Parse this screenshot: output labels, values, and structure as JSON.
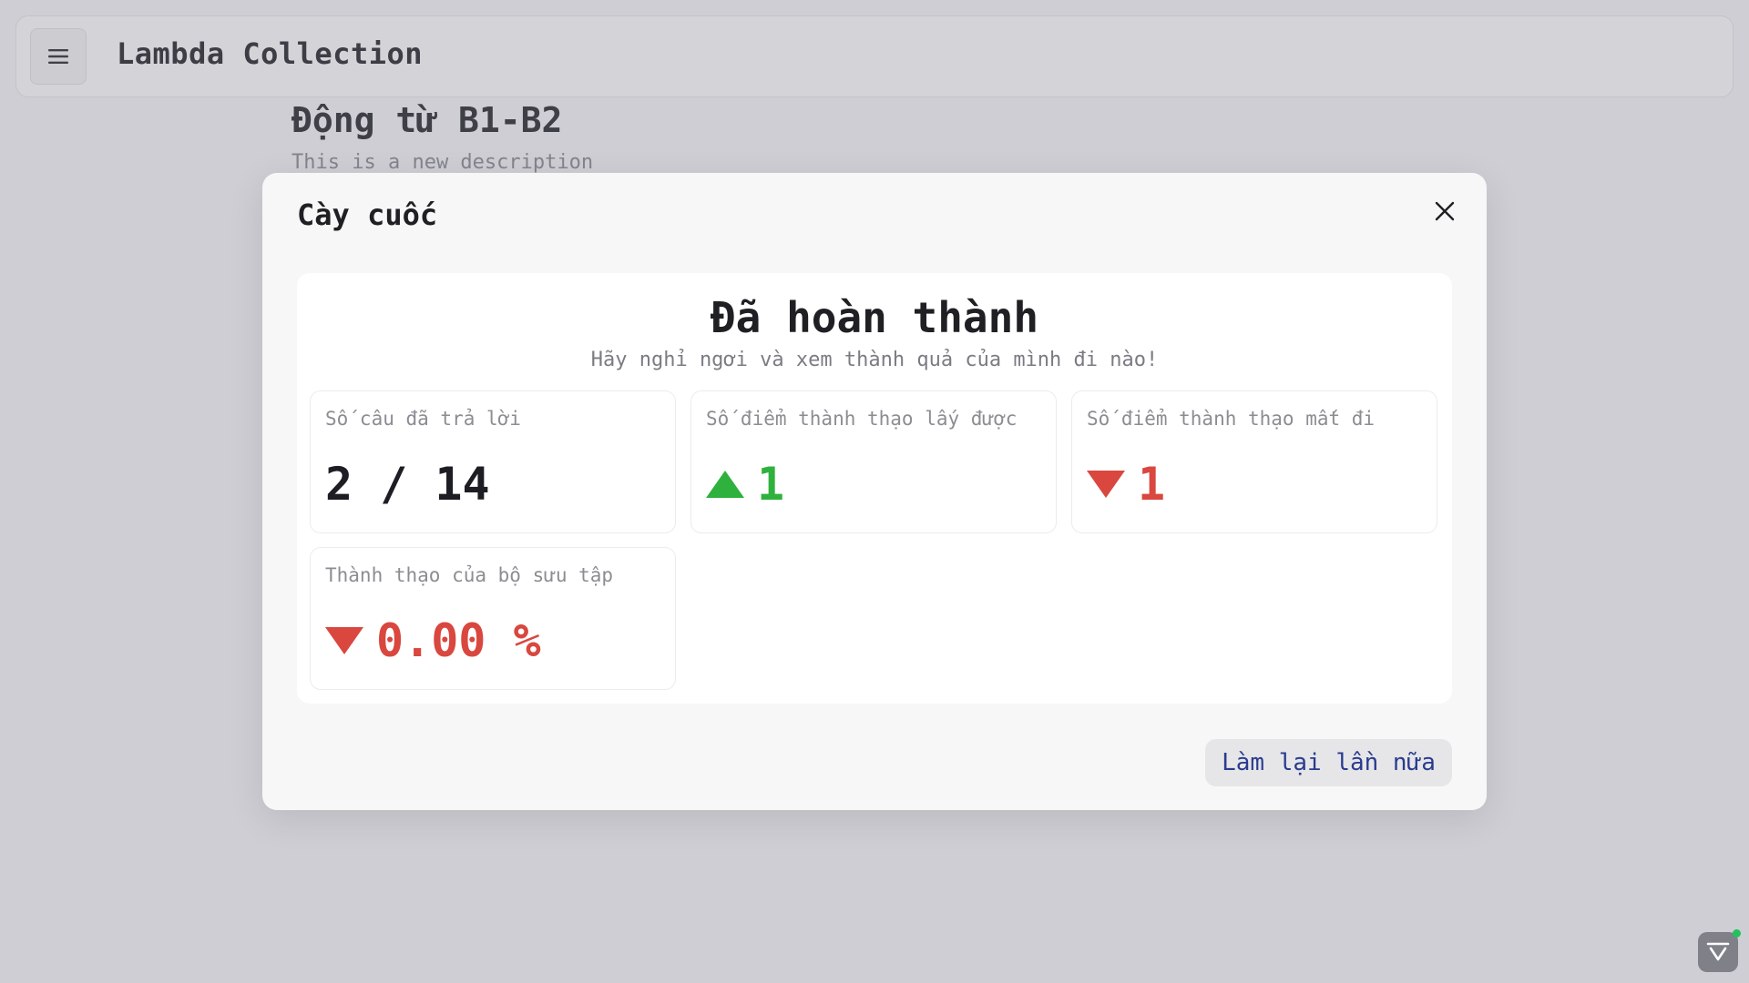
{
  "header": {
    "app_title": "Lambda Collection"
  },
  "background_page": {
    "title": "Động từ B1-B2",
    "description": "This is a new description"
  },
  "modal": {
    "title": "Cày cuốc",
    "result": {
      "title": "Đã hoàn thành",
      "subtitle": "Hãy nghỉ ngơi và xem thành quả của mình đi nào!"
    },
    "stats": [
      {
        "label": "Số câu đã trả lời",
        "value": "2 / 14"
      },
      {
        "label": "Số điểm thành thạo lấy được",
        "value": "1",
        "trend": "up"
      },
      {
        "label": "Số điểm thành thạo mất đi",
        "value": "1",
        "trend": "down"
      },
      {
        "label": "Thành thạo của bộ sưu tập",
        "value": "0.00 %",
        "trend": "down"
      }
    ],
    "retry_label": "Làm lại lần nữa"
  },
  "colors": {
    "positive": "#2fb23d",
    "negative": "#d9473f",
    "button_text": "#2a3b8f"
  },
  "icons": {
    "menu": "hamburger-menu-icon",
    "close": "close-icon",
    "up": "triangle-up-icon",
    "down": "triangle-down-icon",
    "widget": "chat-widget-icon"
  }
}
